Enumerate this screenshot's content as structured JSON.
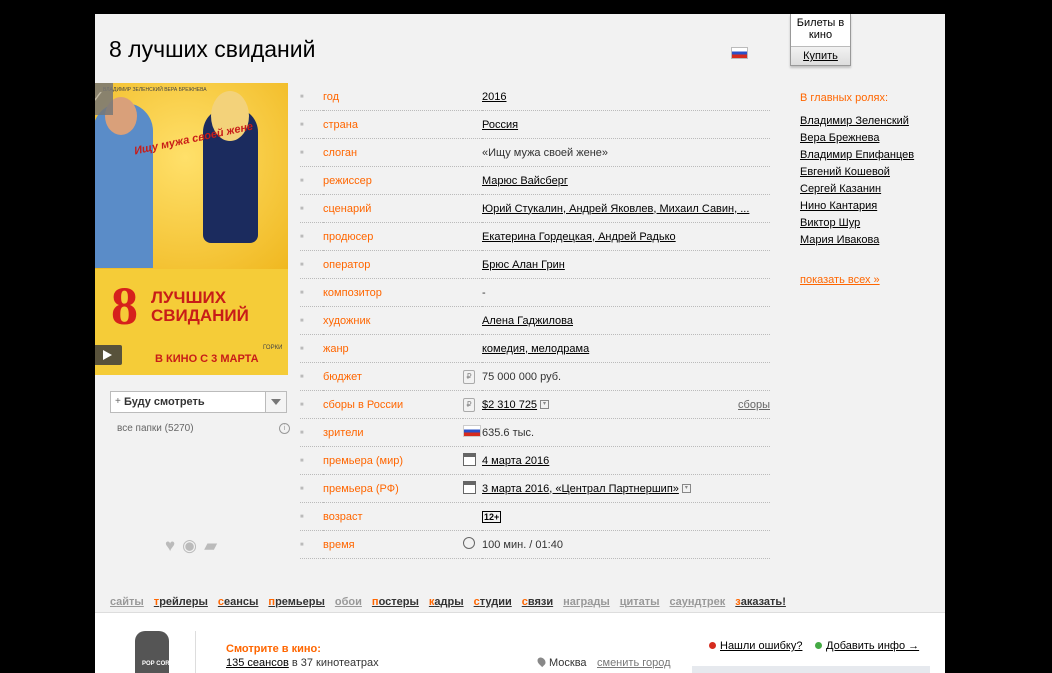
{
  "title": "8 лучших свиданий",
  "tickets": {
    "label": "Билеты в кино",
    "buy": "Купить"
  },
  "poster": {
    "big": "8",
    "words": "ЛУЧШИХ СВИДАНИЙ",
    "date": "В КИНО С 3 МАРТА",
    "slogan": "Ищу мужа своей жене",
    "names": "ВЛАДИМИР ЗЕЛЕНСКИЙ   ВЕРА БРЕЖНЕВА",
    "corner": "ГОРКИ"
  },
  "watch": {
    "plus": "+",
    "label": "Буду смотреть",
    "folders": "все папки (5270)"
  },
  "info_rows": [
    {
      "key": "год",
      "value": "2016",
      "link": true,
      "icon": ""
    },
    {
      "key": "страна",
      "value": "Россия",
      "link": true,
      "icon": ""
    },
    {
      "key": "слоган",
      "value": "«Ищу мужа своей жене»",
      "link": false,
      "icon": ""
    },
    {
      "key": "режиссер",
      "value": "Марюс Вайсберг",
      "link": true,
      "icon": ""
    },
    {
      "key": "сценарий",
      "value": "Юрий Стукалин, Андрей Яковлев, Михаил Савин, ...",
      "link": true,
      "icon": ""
    },
    {
      "key": "продюсер",
      "value": "Екатерина Гордецкая, Андрей Радько",
      "link": true,
      "icon": ""
    },
    {
      "key": "оператор",
      "value": "Брюс Алан Грин",
      "link": true,
      "icon": ""
    },
    {
      "key": "композитор",
      "value": "-",
      "link": false,
      "icon": ""
    },
    {
      "key": "художник",
      "value": "Алена Гаджилова",
      "link": true,
      "icon": ""
    },
    {
      "key": "жанр",
      "value": "комедия, мелодрама",
      "link": true,
      "icon": ""
    },
    {
      "key": "бюджет",
      "value": "75 000 000 руб.",
      "link": false,
      "icon": "ruble"
    },
    {
      "key": "сборы в России",
      "value": "$2 310 725",
      "link": true,
      "icon": "ruble",
      "extra": "сборы"
    },
    {
      "key": "зрители",
      "value": "635.6 тыс.",
      "link": false,
      "icon": "flag"
    },
    {
      "key": "премьера (мир)",
      "value": "4 марта 2016",
      "link": true,
      "icon": "calendar"
    },
    {
      "key": "премьера (РФ)",
      "value": "3 марта 2016, «Централ Партнершип»",
      "link": true,
      "icon": "calendar"
    },
    {
      "key": "возраст",
      "value": "12+",
      "link": false,
      "icon": ""
    },
    {
      "key": "время",
      "value": "100 мин. / 01:40",
      "link": false,
      "icon": "clock"
    }
  ],
  "cast": {
    "heading": "В главных ролях:",
    "actors": [
      "Владимир Зеленский",
      "Вера Брежнева",
      "Владимир Епифанцев",
      "Евгений Кошевой",
      "Сергей Казанин",
      "Нино Кантария",
      "Виктор Шур",
      "Мария Ивакова"
    ],
    "more": "показать всех »"
  },
  "tabs": [
    {
      "first": "с",
      "rest": "айты",
      "active": false
    },
    {
      "first": "т",
      "rest": "рейлеры",
      "active": true
    },
    {
      "first": "с",
      "rest": "еансы",
      "active": true
    },
    {
      "first": "п",
      "rest": "ремьеры",
      "active": true
    },
    {
      "first": "о",
      "rest": "бои",
      "active": false
    },
    {
      "first": "п",
      "rest": "остеры",
      "active": true
    },
    {
      "first": "к",
      "rest": "адры",
      "active": true
    },
    {
      "first": "с",
      "rest": "тудии",
      "active": true
    },
    {
      "first": "с",
      "rest": "вязи",
      "active": true
    },
    {
      "first": "н",
      "rest": "аграды",
      "active": false
    },
    {
      "first": "ц",
      "rest": "итаты",
      "active": false
    },
    {
      "first": "с",
      "rest": "аундтрек",
      "active": false
    },
    {
      "first": "з",
      "rest": "аказать!",
      "active": true
    }
  ],
  "bottom": {
    "popcorn": "POP CORN",
    "cinema_heading": "Смотрите в кино:",
    "sessions_link": "135 сеансов",
    "sessions_rest": " в 37 кинотеатрах",
    "city": "Москва",
    "change_city": "сменить город",
    "error": "Нашли ошибку?",
    "add_info": "Добавить инфо →"
  },
  "colors": {
    "accent": "#ff6600",
    "background": "#f2f2f2"
  }
}
